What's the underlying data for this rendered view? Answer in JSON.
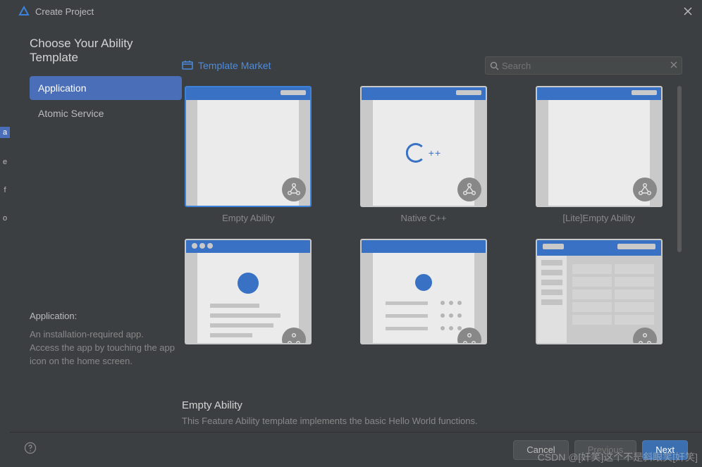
{
  "window": {
    "title": "Create Project"
  },
  "heading": "Choose Your Ability Template",
  "sidebar": {
    "items": [
      {
        "label": "Application",
        "active": true
      },
      {
        "label": "Atomic Service",
        "active": false
      }
    ],
    "info_title": "Application:",
    "info_text": "An installation-required app. Access the app by touching the app icon on the home screen."
  },
  "main": {
    "market_label": "Template Market",
    "search_placeholder": "Search"
  },
  "templates": [
    {
      "label": "Empty Ability"
    },
    {
      "label": "Native C++"
    },
    {
      "label": "[Lite]Empty Ability"
    },
    {
      "label": ""
    },
    {
      "label": ""
    },
    {
      "label": ""
    }
  ],
  "description": {
    "title": "Empty Ability",
    "text": "This Feature Ability template implements the basic Hello World functions."
  },
  "footer": {
    "cancel": "Cancel",
    "previous": "Previous",
    "next": "Next"
  },
  "strip": {
    "a": "a",
    "b": "e",
    "c": "f",
    "d": "o"
  },
  "watermark": "CSDN @[奸笑]这个不是斜眼笑[奸笑]"
}
